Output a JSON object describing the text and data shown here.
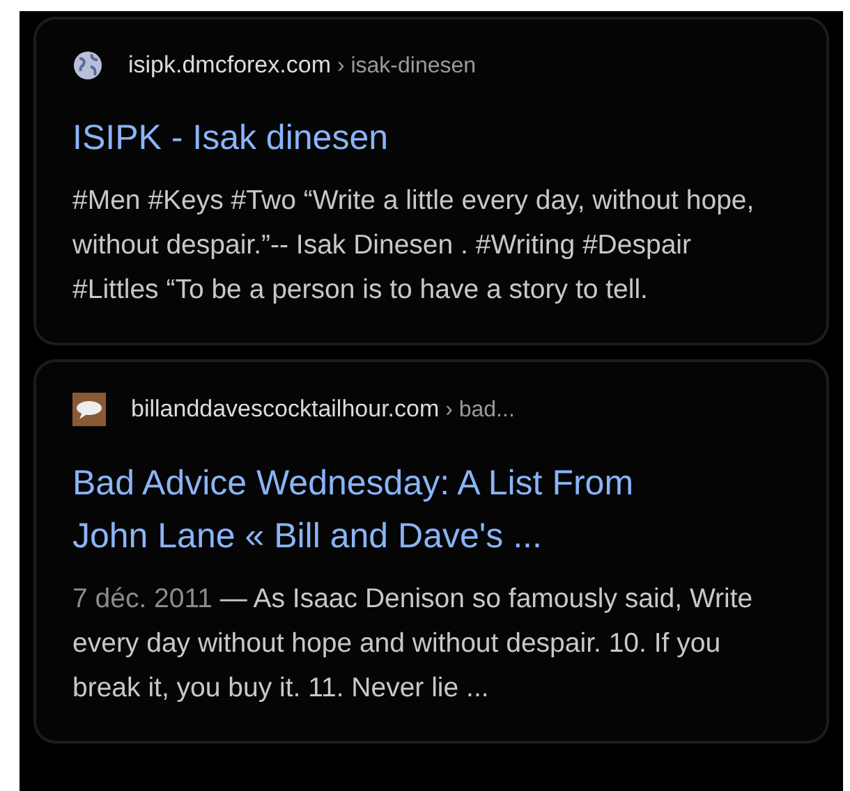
{
  "results": [
    {
      "kind": "globe",
      "domain": "isipk.dmcforex.com",
      "path": "› isak-dinesen",
      "title": [
        "ISIPK - Isak dinesen"
      ],
      "snippet": "#Men #Keys #Two “Write a little every day, without hope, without despair.”-- Isak Dinesen . #Writing #Despair #Littles “To be a person is to have a story to tell."
    },
    {
      "kind": "speech",
      "domain": "billanddavescocktailhour.com",
      "path": "› bad...",
      "title": [
        "Bad Advice Wednesday: A List From",
        "John Lane « Bill and Dave's ..."
      ],
      "date": "7 déc. 2011",
      "snippet": "— As Isaac Denison so famously said, Write every day without hope and without despair. 10. If you break it, you buy it. 11. Never lie ..."
    }
  ]
}
